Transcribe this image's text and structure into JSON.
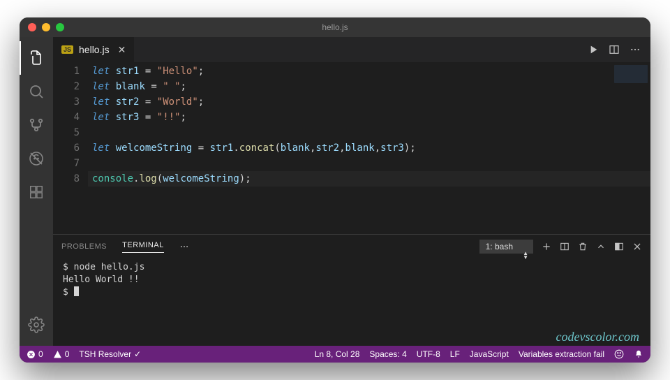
{
  "titlebar": {
    "title": "hello.js"
  },
  "tab": {
    "filename": "hello.js",
    "badge": "JS"
  },
  "editor": {
    "lines": [
      [
        {
          "t": "kw",
          "v": "let"
        },
        {
          "t": "sp",
          "v": " "
        },
        {
          "t": "var",
          "v": "str1"
        },
        {
          "t": "sp",
          "v": " "
        },
        {
          "t": "op",
          "v": "="
        },
        {
          "t": "sp",
          "v": " "
        },
        {
          "t": "str",
          "v": "\"Hello\""
        },
        {
          "t": "punc",
          "v": ";"
        }
      ],
      [
        {
          "t": "kw",
          "v": "let"
        },
        {
          "t": "sp",
          "v": " "
        },
        {
          "t": "var",
          "v": "blank"
        },
        {
          "t": "sp",
          "v": " "
        },
        {
          "t": "op",
          "v": "="
        },
        {
          "t": "sp",
          "v": " "
        },
        {
          "t": "str",
          "v": "\" \""
        },
        {
          "t": "punc",
          "v": ";"
        }
      ],
      [
        {
          "t": "kw",
          "v": "let"
        },
        {
          "t": "sp",
          "v": " "
        },
        {
          "t": "var",
          "v": "str2"
        },
        {
          "t": "sp",
          "v": " "
        },
        {
          "t": "op",
          "v": "="
        },
        {
          "t": "sp",
          "v": " "
        },
        {
          "t": "str",
          "v": "\"World\""
        },
        {
          "t": "punc",
          "v": ";"
        }
      ],
      [
        {
          "t": "kw",
          "v": "let"
        },
        {
          "t": "sp",
          "v": " "
        },
        {
          "t": "var",
          "v": "str3"
        },
        {
          "t": "sp",
          "v": " "
        },
        {
          "t": "op",
          "v": "="
        },
        {
          "t": "sp",
          "v": " "
        },
        {
          "t": "str",
          "v": "\"!!\""
        },
        {
          "t": "punc",
          "v": ";"
        }
      ],
      [],
      [
        {
          "t": "kw",
          "v": "let"
        },
        {
          "t": "sp",
          "v": " "
        },
        {
          "t": "var",
          "v": "welcomeString"
        },
        {
          "t": "sp",
          "v": " "
        },
        {
          "t": "op",
          "v": "="
        },
        {
          "t": "sp",
          "v": " "
        },
        {
          "t": "var",
          "v": "str1"
        },
        {
          "t": "punc",
          "v": "."
        },
        {
          "t": "fn",
          "v": "concat"
        },
        {
          "t": "punc",
          "v": "("
        },
        {
          "t": "var",
          "v": "blank"
        },
        {
          "t": "punc",
          "v": ","
        },
        {
          "t": "var",
          "v": "str2"
        },
        {
          "t": "punc",
          "v": ","
        },
        {
          "t": "var",
          "v": "blank"
        },
        {
          "t": "punc",
          "v": ","
        },
        {
          "t": "var",
          "v": "str3"
        },
        {
          "t": "punc",
          "v": ")"
        },
        {
          "t": "punc",
          "v": ";"
        }
      ],
      [],
      [
        {
          "t": "obj",
          "v": "console"
        },
        {
          "t": "punc",
          "v": "."
        },
        {
          "t": "fn",
          "v": "log"
        },
        {
          "t": "punc",
          "v": "("
        },
        {
          "t": "var",
          "v": "welcomeString"
        },
        {
          "t": "punc",
          "v": ")"
        },
        {
          "t": "punc",
          "v": ";"
        }
      ]
    ],
    "active_line_index": 7
  },
  "panel": {
    "tabs": {
      "problems": "PROBLEMS",
      "terminal": "TERMINAL"
    },
    "terminal_selector": "1: bash",
    "output": [
      "$ node hello.js",
      "Hello World !!",
      "$ "
    ]
  },
  "watermark": "codevscolor.com",
  "statusbar": {
    "errors": "0",
    "warnings": "0",
    "tsh": "TSH Resolver",
    "cursor": "Ln 8, Col 28",
    "spaces": "Spaces: 4",
    "encoding": "UTF-8",
    "eol": "LF",
    "language": "JavaScript",
    "extra": "Variables extraction fail"
  }
}
